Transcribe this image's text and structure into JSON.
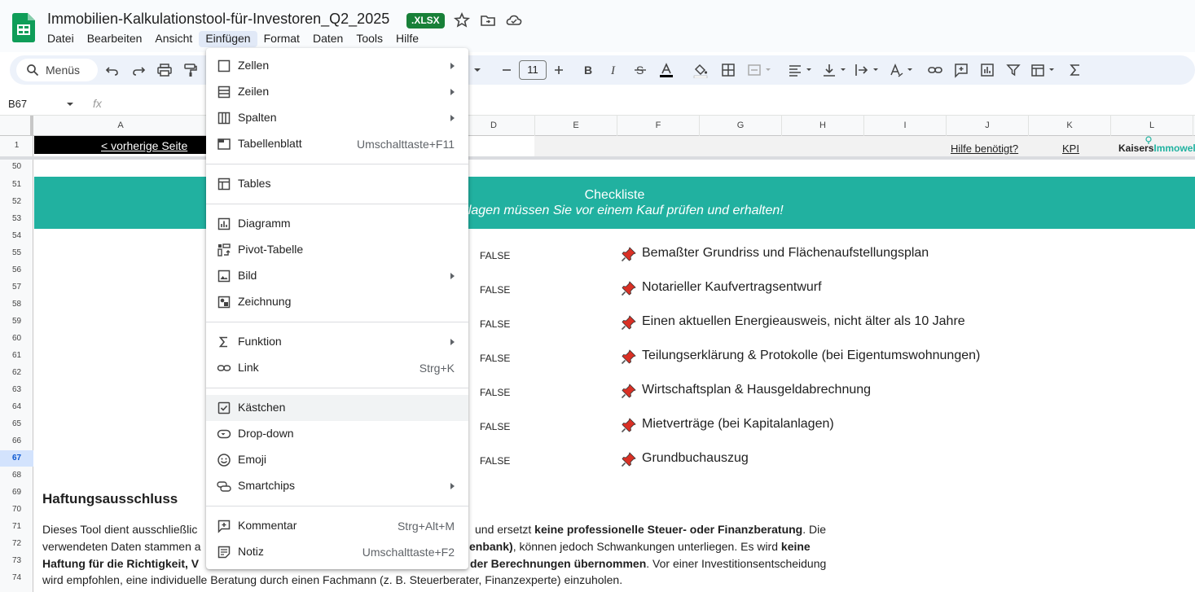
{
  "header": {
    "title": "Immobilien-Kalkulationstool-für-Investoren_Q2_2025",
    "badge": ".XLSX",
    "menus": [
      "Datei",
      "Bearbeiten",
      "Ansicht",
      "Einfügen",
      "Format",
      "Daten",
      "Tools",
      "Hilfe"
    ],
    "active_menu": "Einfügen"
  },
  "toolbar": {
    "search_label": "Menüs",
    "font_size": "11"
  },
  "formula_bar": {
    "name_box": "B67",
    "fx": "fx"
  },
  "grid": {
    "columns": [
      "A",
      "D",
      "E",
      "F",
      "G",
      "H",
      "I",
      "J",
      "K",
      "L"
    ],
    "rows": [
      "1",
      "50",
      "51",
      "52",
      "53",
      "54",
      "55",
      "56",
      "57",
      "58",
      "59",
      "60",
      "61",
      "62",
      "63",
      "64",
      "65",
      "66",
      "67",
      "68",
      "69",
      "70",
      "71",
      "72",
      "73",
      "74"
    ],
    "selected_row": "67",
    "row1": {
      "prev_page": "< vorherige Seite",
      "help": "Hilfe benötigt?",
      "kpi": "KPI",
      "logo_part1": "Kaisers",
      "logo_part2": "Immowelt"
    },
    "checklist": {
      "title": "Checkliste",
      "subtitle": "nterlagen müssen Sie vor einem Kauf prüfen und erhalten!",
      "items": [
        {
          "value": "FALSE",
          "text": "Bemaßter Grundriss und Flächenaufstellungsplan"
        },
        {
          "value": "FALSE",
          "text": "Notarieller Kaufvertragsentwurf"
        },
        {
          "value": "FALSE",
          "text": "Einen aktuellen Energieausweis, nicht älter als 10 Jahre"
        },
        {
          "value": "FALSE",
          "text": "Teilungserklärung & Protokolle (bei Eigentumswohnungen)"
        },
        {
          "value": "FALSE",
          "text": "Wirtschaftsplan & Hausgeldabrechnung"
        },
        {
          "value": "FALSE",
          "text": "Mietverträge (bei Kapitalanlagen)"
        },
        {
          "value": "FALSE",
          "text": "Grundbuchauszug"
        }
      ]
    },
    "disclaimer": {
      "title": "Haftungsausschluss",
      "l1a": "Dieses Tool dient ausschließlic",
      "l1b": "und ersetzt ",
      "l1c": "keine professionelle Steuer- oder Finanzberatung",
      "l1d": ". Die",
      "l2a": "verwendeten Daten stammen a",
      "l2b": "enbank)",
      "l2c": ", können jedoch Schwankungen unterliegen. Es wird ",
      "l2d": "keine",
      "l3a": "Haftung für die Richtigkeit, V",
      "l3b": "der Berechnungen übernommen",
      "l3c": ". Vor einer Investitionsentscheidung",
      "l4": "wird empfohlen, eine individuelle Beratung durch einen Fachmann (z. B. Steuerberater, Finanzexperte) einzuholen."
    }
  },
  "insert_menu": {
    "items": [
      {
        "label": "Zellen",
        "icon": "cell-icon",
        "submenu": true
      },
      {
        "label": "Zeilen",
        "icon": "rows-icon",
        "submenu": true
      },
      {
        "label": "Spalten",
        "icon": "columns-icon",
        "submenu": true
      },
      {
        "label": "Tabellenblatt",
        "icon": "sheet-icon",
        "shortcut": "Umschalttaste+F11"
      },
      {
        "label": "Tables",
        "icon": "table-icon"
      },
      {
        "label": "Diagramm",
        "icon": "chart-icon"
      },
      {
        "label": "Pivot-Tabelle",
        "icon": "pivot-icon"
      },
      {
        "label": "Bild",
        "icon": "image-icon",
        "submenu": true
      },
      {
        "label": "Zeichnung",
        "icon": "drawing-icon"
      },
      {
        "label": "Funktion",
        "icon": "sigma-icon",
        "submenu": true
      },
      {
        "label": "Link",
        "icon": "link-icon",
        "shortcut": "Strg+K"
      },
      {
        "label": "Kästchen",
        "icon": "checkbox-icon"
      },
      {
        "label": "Drop-down",
        "icon": "dropdown-icon"
      },
      {
        "label": "Emoji",
        "icon": "emoji-icon"
      },
      {
        "label": "Smartchips",
        "icon": "smartchips-icon",
        "submenu": true
      },
      {
        "label": "Kommentar",
        "icon": "comment-icon",
        "shortcut": "Strg+Alt+M"
      },
      {
        "label": "Notiz",
        "icon": "note-icon",
        "shortcut": "Umschalttaste+F2"
      }
    ],
    "hovered": "Kästchen"
  },
  "colors": {
    "teal_banner": "#21b1a0",
    "badge_green": "#188038",
    "pin_red": "#d93025"
  }
}
